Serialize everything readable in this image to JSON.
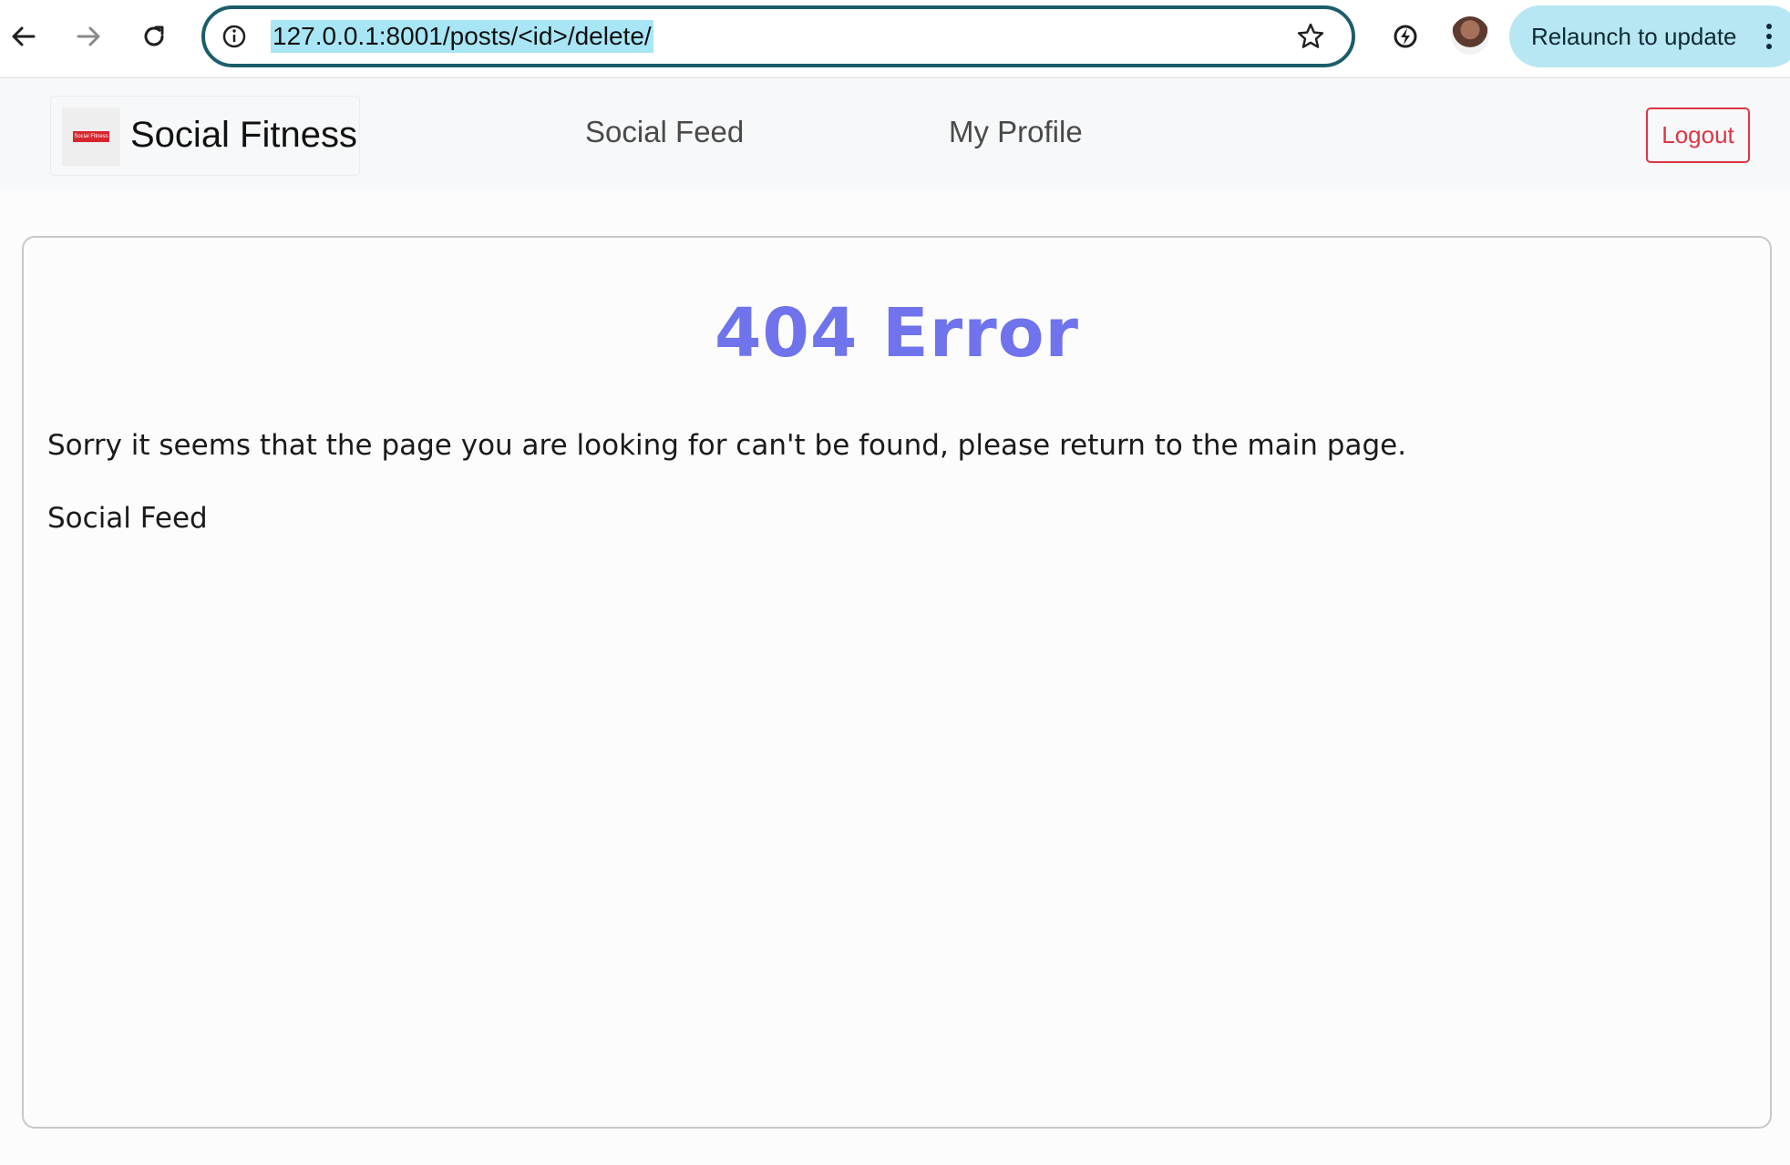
{
  "browser": {
    "url": "127.0.0.1:8001/posts/<id>/delete/",
    "relaunch_label": "Relaunch to update",
    "icons": [
      "back-arrow-icon",
      "forward-arrow-icon",
      "reload-icon",
      "info-icon",
      "star-icon",
      "extension-icon",
      "profile-avatar",
      "kebab-menu-icon"
    ]
  },
  "navbar": {
    "brand_name": "Social Fitness",
    "brand_logo_text": "Social Fitness",
    "links": [
      {
        "label": "Social Feed"
      },
      {
        "label": "My Profile"
      }
    ],
    "logout_label": "Logout",
    "logout_color": "#dc3545"
  },
  "main": {
    "title": "404 Error",
    "title_color": "#6f73ec",
    "message": "Sorry it seems that the page you are looking for can't be found, please return to the main page.",
    "link_label": "Social Feed"
  }
}
